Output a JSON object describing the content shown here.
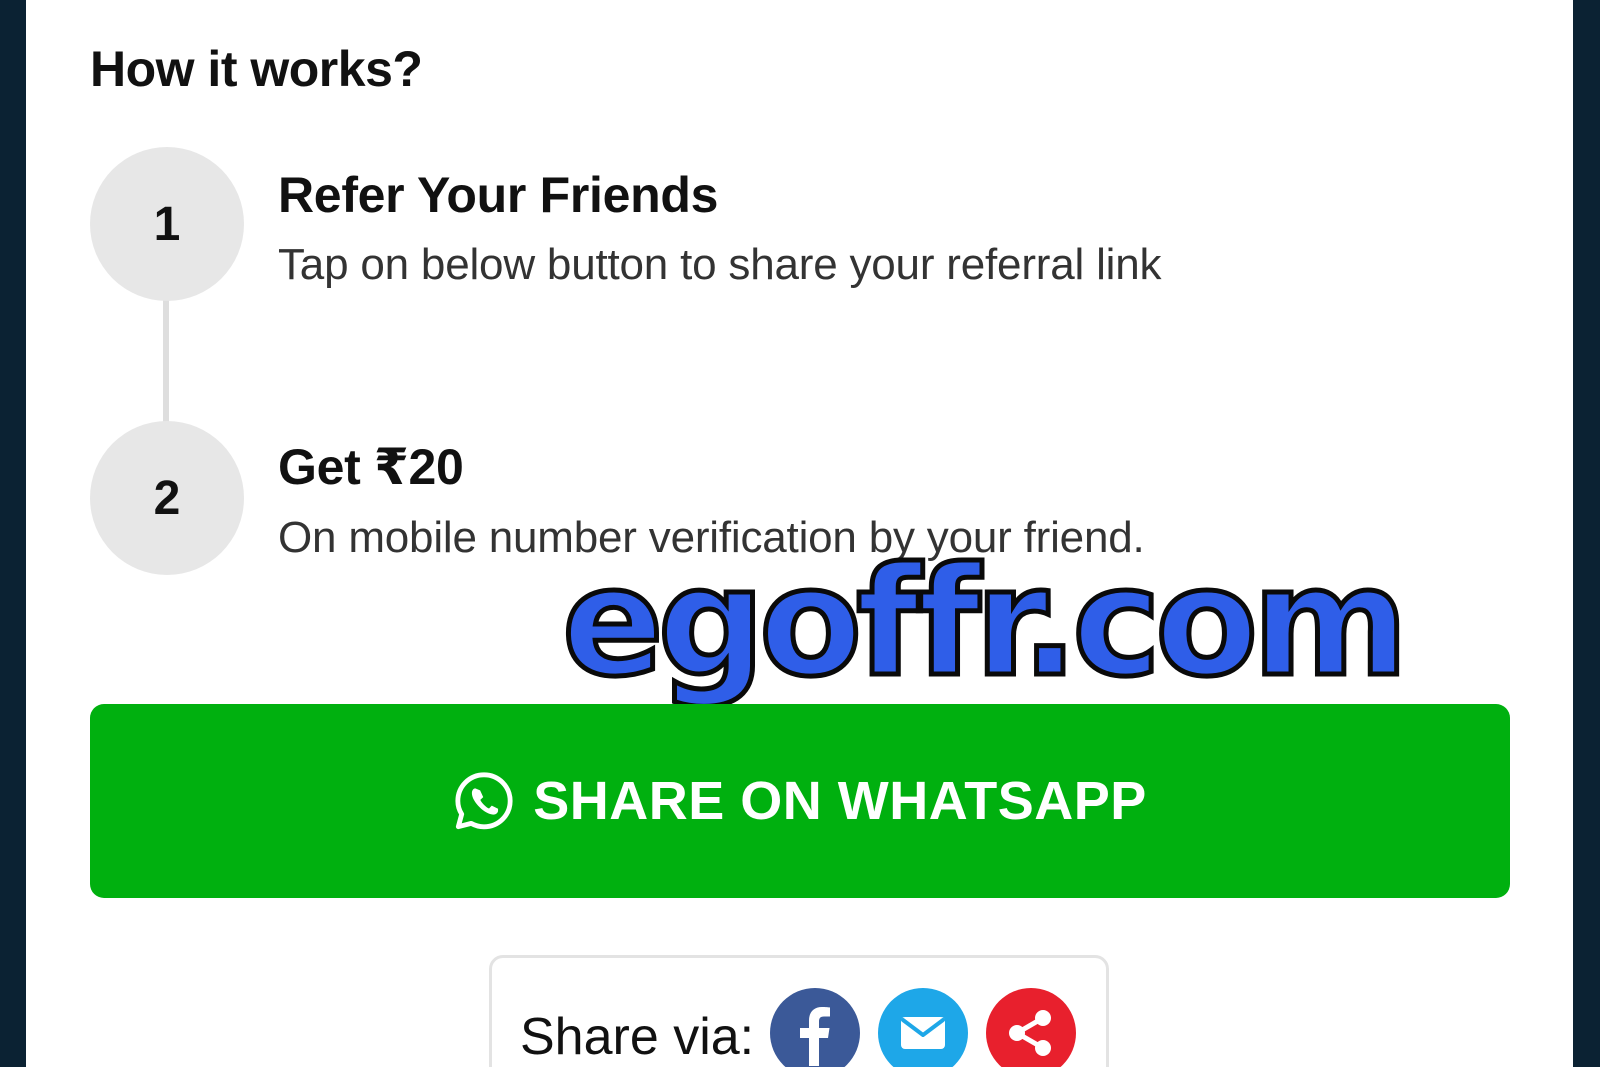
{
  "how_it_works": {
    "title": "How it works?",
    "steps": [
      {
        "number": "1",
        "title": "Refer Your Friends",
        "description": "Tap on below button to share your referral link"
      },
      {
        "number": "2",
        "title": "Get ₹20",
        "description": "On mobile number verification by your friend."
      }
    ]
  },
  "watermark": "egoffr.com",
  "whatsapp_button": {
    "label": "SHARE ON WHATSAPP",
    "icon": "whatsapp-icon",
    "color": "#00b00f"
  },
  "share_via": {
    "label": "Share via:",
    "options": [
      {
        "icon": "facebook-icon",
        "color": "#3b5998"
      },
      {
        "icon": "mail-icon",
        "color": "#1ea7e8"
      },
      {
        "icon": "share-icon",
        "color": "#e8202d"
      }
    ]
  }
}
